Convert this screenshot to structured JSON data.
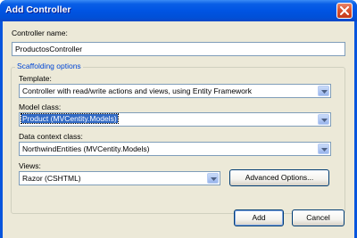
{
  "dialog": {
    "title": "Add Controller"
  },
  "controller_name": {
    "label": "Controller name:",
    "value": "ProductosController"
  },
  "scaffolding": {
    "group_title": "Scaffolding options",
    "template": {
      "label": "Template:",
      "value": "Controller with read/write actions and views, using Entity Framework"
    },
    "model_class": {
      "label": "Model class:",
      "value": "Product (MVCentity.Models)"
    },
    "data_context_class": {
      "label": "Data context class:",
      "value": "NorthwindEntities (MVCentity.Models)"
    },
    "views": {
      "label": "Views:",
      "value": "Razor (CSHTML)"
    },
    "advanced_options_label": "Advanced Options..."
  },
  "buttons": {
    "add_label": "Add",
    "cancel_label": "Cancel"
  },
  "colors": {
    "titlebar": "#0054e3",
    "client": "#ece9d8",
    "group_title": "#0046d5",
    "selection": "#316ac5"
  }
}
